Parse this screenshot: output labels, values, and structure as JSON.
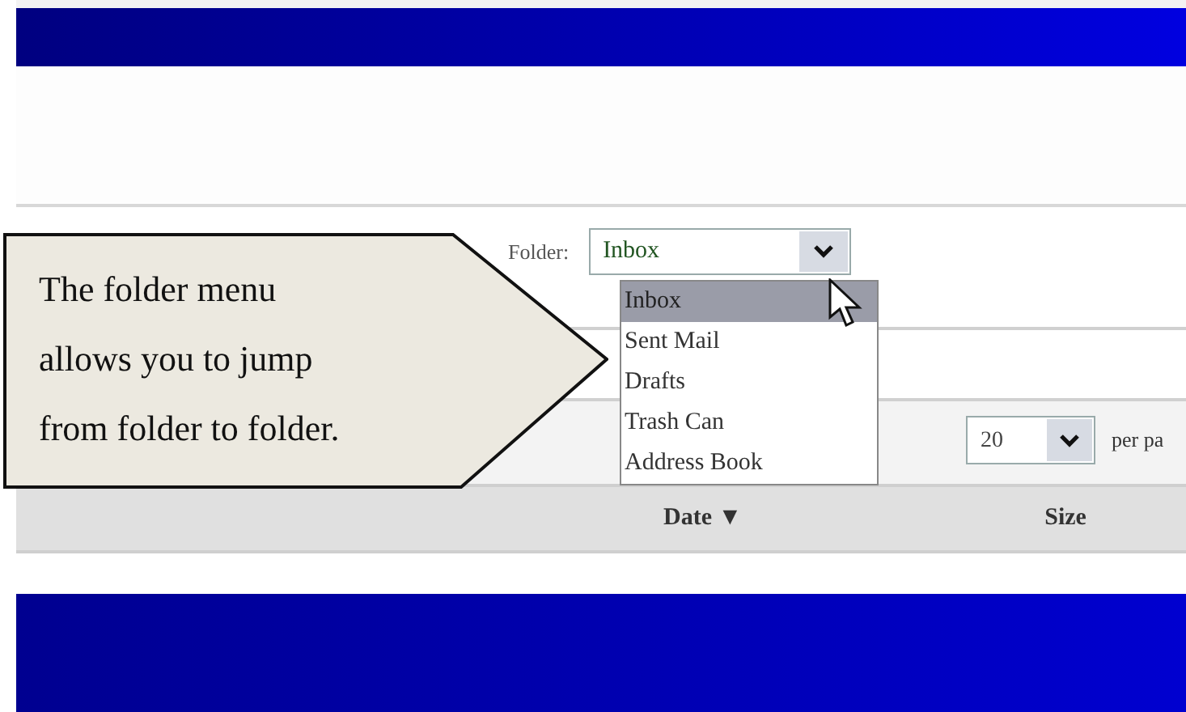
{
  "folder_bar": {
    "label": "Folder:",
    "value": "Inbox"
  },
  "folder_menu": {
    "options": [
      {
        "label": "Inbox",
        "selected": true
      },
      {
        "label": "Sent Mail",
        "selected": false
      },
      {
        "label": "Drafts",
        "selected": false
      },
      {
        "label": "Trash Can",
        "selected": false
      },
      {
        "label": "Address Book",
        "selected": false
      }
    ]
  },
  "pager": {
    "value": "20",
    "suffix": "per pa"
  },
  "table": {
    "columns": [
      {
        "label": "Date",
        "sort": "▼"
      },
      {
        "label": "Size"
      }
    ]
  },
  "callout": {
    "lines": [
      "The folder menu",
      "allows you to jump",
      "from folder to folder."
    ]
  }
}
